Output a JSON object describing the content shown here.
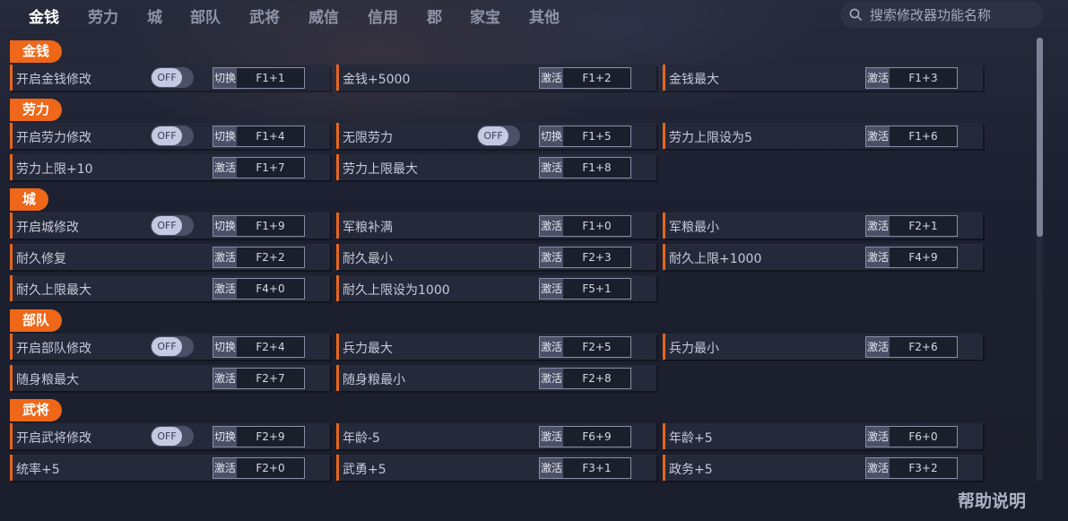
{
  "nav": {
    "tabs": [
      "金钱",
      "劳力",
      "城",
      "部队",
      "武将",
      "威信",
      "信用",
      "郡",
      "家宝",
      "其他"
    ],
    "active_tab": "金钱"
  },
  "search": {
    "placeholder": "搜索修改器功能名称"
  },
  "colors": {
    "accent": "#ef6718",
    "background": "#1c1f2c",
    "row": "#252a3b"
  },
  "help_label": "帮助说明",
  "sections": [
    {
      "title": "金钱",
      "rows": [
        [
          {
            "label": "开启金钱修改",
            "toggle": "OFF",
            "type": "切换",
            "key": "F1+1"
          },
          {
            "label": "金钱+5000",
            "type": "激活",
            "key": "F1+2"
          },
          {
            "label": "金钱最大",
            "type": "激活",
            "key": "F1+3"
          }
        ]
      ]
    },
    {
      "title": "劳力",
      "rows": [
        [
          {
            "label": "开启劳力修改",
            "toggle": "OFF",
            "type": "切换",
            "key": "F1+4"
          },
          {
            "label": "无限劳力",
            "toggle": "OFF",
            "type": "切换",
            "key": "F1+5"
          },
          {
            "label": "劳力上限设为5",
            "type": "激活",
            "key": "F1+6"
          }
        ],
        [
          {
            "label": "劳力上限+10",
            "type": "激活",
            "key": "F1+7"
          },
          {
            "label": "劳力上限最大",
            "type": "激活",
            "key": "F1+8"
          }
        ]
      ]
    },
    {
      "title": "城",
      "rows": [
        [
          {
            "label": "开启城修改",
            "toggle": "OFF",
            "type": "切换",
            "key": "F1+9"
          },
          {
            "label": "军粮补满",
            "type": "激活",
            "key": "F1+0"
          },
          {
            "label": "军粮最小",
            "type": "激活",
            "key": "F2+1"
          }
        ],
        [
          {
            "label": "耐久修复",
            "type": "激活",
            "key": "F2+2"
          },
          {
            "label": "耐久最小",
            "type": "激活",
            "key": "F2+3"
          },
          {
            "label": "耐久上限+1000",
            "type": "激活",
            "key": "F4+9"
          }
        ],
        [
          {
            "label": "耐久上限最大",
            "type": "激活",
            "key": "F4+0"
          },
          {
            "label": "耐久上限设为1000",
            "type": "激活",
            "key": "F5+1"
          }
        ]
      ]
    },
    {
      "title": "部队",
      "rows": [
        [
          {
            "label": "开启部队修改",
            "toggle": "OFF",
            "type": "切换",
            "key": "F2+4"
          },
          {
            "label": "兵力最大",
            "type": "激活",
            "key": "F2+5"
          },
          {
            "label": "兵力最小",
            "type": "激活",
            "key": "F2+6"
          }
        ],
        [
          {
            "label": "随身粮最大",
            "type": "激活",
            "key": "F2+7"
          },
          {
            "label": "随身粮最小",
            "type": "激活",
            "key": "F2+8"
          }
        ]
      ]
    },
    {
      "title": "武将",
      "rows": [
        [
          {
            "label": "开启武将修改",
            "toggle": "OFF",
            "type": "切换",
            "key": "F2+9"
          },
          {
            "label": "年龄-5",
            "type": "激活",
            "key": "F6+9"
          },
          {
            "label": "年龄+5",
            "type": "激活",
            "key": "F6+0"
          }
        ],
        [
          {
            "label": "统率+5",
            "type": "激活",
            "key": "F2+0"
          },
          {
            "label": "武勇+5",
            "type": "激活",
            "key": "F3+1"
          },
          {
            "label": "政务+5",
            "type": "激活",
            "key": "F3+2"
          }
        ]
      ]
    }
  ]
}
